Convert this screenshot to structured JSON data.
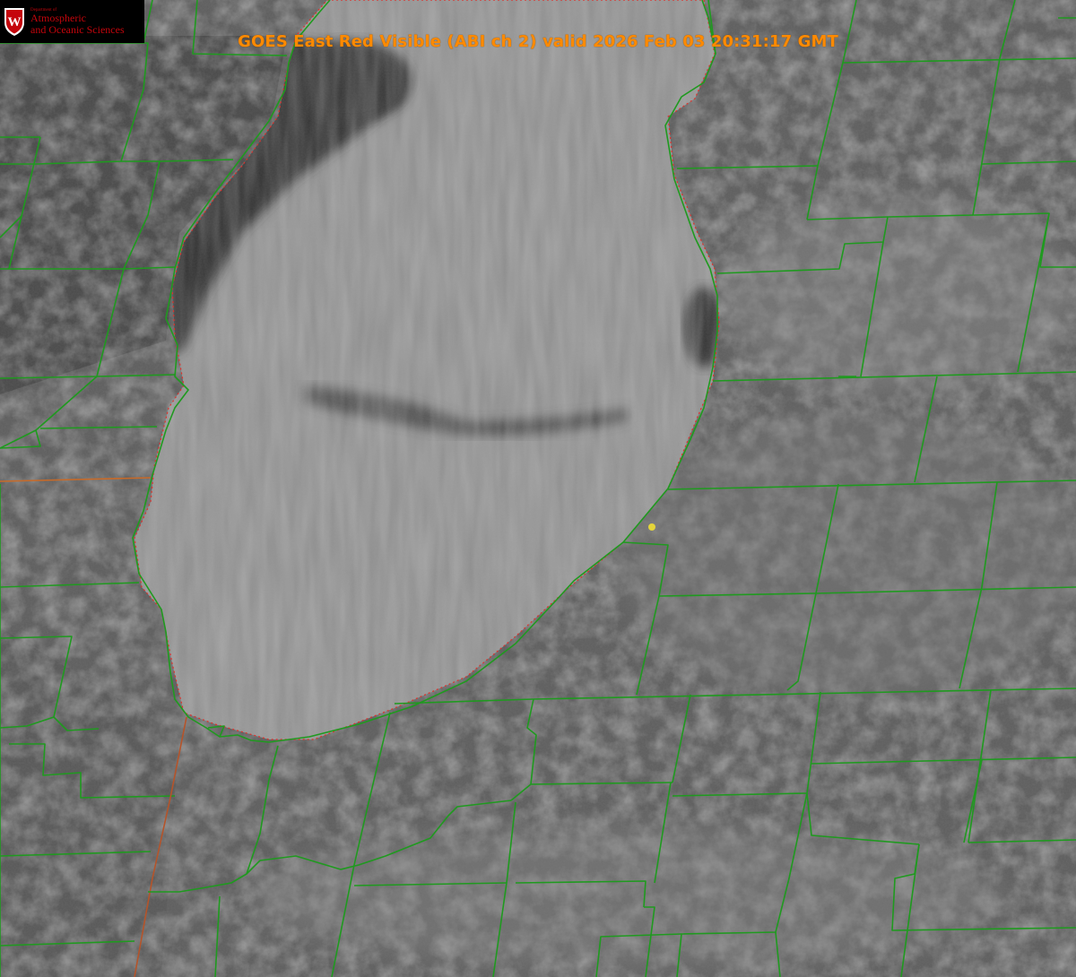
{
  "title": "GOES East Red Visible (ABI ch 2) valid 2026 Feb 03 20:31:17 GMT",
  "logo": {
    "department": "Department of",
    "line1": "Atmospheric",
    "line2": "and Oceanic Sciences",
    "crest_letter": "W"
  },
  "colors": {
    "title": "#ff8a00",
    "boundaries": "#1f9a1f",
    "state_line": "#d83a1a",
    "marker": "#e5d53a",
    "logo_text": "#c5050c",
    "crest": "#c5050c"
  },
  "icons": {
    "crest": "uw-crest-icon",
    "marker": "location-dot-icon"
  }
}
